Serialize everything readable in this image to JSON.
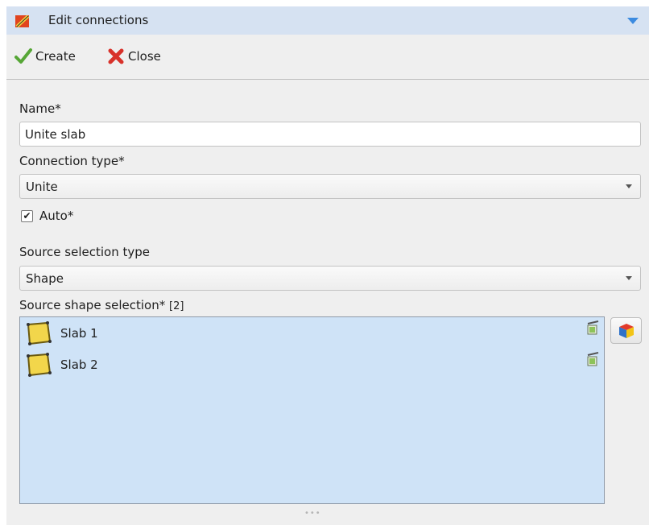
{
  "panel": {
    "title": "Edit connections",
    "title_icon": "bim-connection-icon",
    "collapse_icon": "chevron-down-icon",
    "accent": "#d6e2f2"
  },
  "toolbar": {
    "create_label": "Create",
    "create_icon": "checkmark-icon",
    "close_label": "Close",
    "close_icon": "close-icon"
  },
  "form": {
    "name_label": "Name*",
    "name_value": "Unite slab",
    "connection_type_label": "Connection type*",
    "connection_type_value": "Unite",
    "auto_label": "Auto*",
    "auto_checked": true,
    "source_selection_type_label": "Source selection type",
    "source_selection_type_value": "Shape",
    "source_shape_selection_label": "Source shape selection*",
    "source_shape_selection_count": "[2]"
  },
  "source_shapes": [
    {
      "label": "Slab 1",
      "icon": "slab-icon",
      "remove_icon": "remove-from-selection-icon"
    },
    {
      "label": "Slab 2",
      "icon": "slab-icon",
      "remove_icon": "remove-from-selection-icon"
    }
  ],
  "pick_button_icon": "pick-3d-shape-icon",
  "colors": {
    "list_background": "#cfe3f7",
    "panel_background": "#efefef",
    "slab_fill": "#f2d64b"
  }
}
